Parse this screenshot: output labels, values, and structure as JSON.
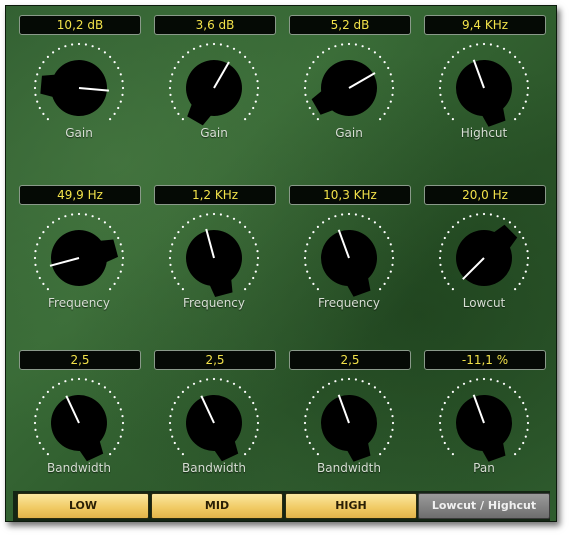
{
  "rows": [
    [
      {
        "value": "10,2 dB",
        "label": "Gain",
        "angle": 95
      },
      {
        "value": "3,6 dB",
        "label": "Gain",
        "angle": 30
      },
      {
        "value": "5,2 dB",
        "label": "Gain",
        "angle": 60
      },
      {
        "value": "9,4 KHz",
        "label": "Highcut",
        "angle": -20
      }
    ],
    [
      {
        "value": "49,9 Hz",
        "label": "Frequency",
        "angle": -105
      },
      {
        "value": "1,2 KHz",
        "label": "Frequency",
        "angle": -15
      },
      {
        "value": "10,3 KHz",
        "label": "Frequency",
        "angle": -20
      },
      {
        "value": "20,0 Hz",
        "label": "Lowcut",
        "angle": -135
      }
    ],
    [
      {
        "value": "2,5",
        "label": "Bandwidth",
        "angle": -25
      },
      {
        "value": "2,5",
        "label": "Bandwidth",
        "angle": -25
      },
      {
        "value": "2,5",
        "label": "Bandwidth",
        "angle": -20
      },
      {
        "value": "-11,1 %",
        "label": "Pan",
        "angle": -20
      }
    ]
  ],
  "bands": [
    {
      "label": "LOW",
      "active": true
    },
    {
      "label": "MID",
      "active": true
    },
    {
      "label": "HIGH",
      "active": true
    },
    {
      "label": "Lowcut / Highcut",
      "active": false
    }
  ],
  "colors": {
    "value_text": "#f2e24a",
    "knob": "#000000",
    "pointer": "#ffffff",
    "dots": "#ffffff"
  },
  "icons": {
    "knob": "rotary-knob-icon"
  }
}
